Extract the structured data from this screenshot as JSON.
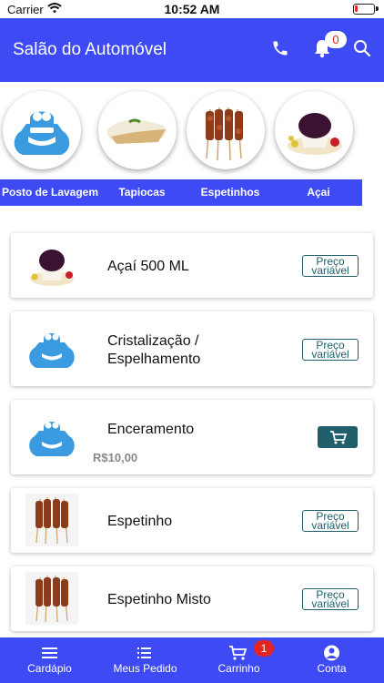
{
  "status_bar": {
    "carrier": "Carrier",
    "time": "10:52 AM",
    "battery_level": 0.15
  },
  "header": {
    "title": "Salão do Automóvel",
    "notification_count": "0"
  },
  "categories": [
    {
      "label": "Posto de Lavagem",
      "icon": "car-wash-logo-icon"
    },
    {
      "label": "Tapiocas",
      "icon": "tapioca-image"
    },
    {
      "label": "Espetinhos",
      "icon": "skewers-image"
    },
    {
      "label": "Açai",
      "icon": "acai-image"
    }
  ],
  "products": [
    {
      "name": "Açaí 500 ML",
      "price_line1": "Preço",
      "price_line2": "variável",
      "icon": "acai-image"
    },
    {
      "name_line1": "Cristalização /",
      "name_line2": "Espelhamento",
      "price_line1": "Preço",
      "price_line2": "variável",
      "icon": "car-wash-logo-icon"
    },
    {
      "name": "Enceramento",
      "price": "R$10,00",
      "icon": "car-wash-logo-icon",
      "action": "cart-icon"
    },
    {
      "name": "Espetinho",
      "price_line1": "Preço",
      "price_line2": "variável",
      "icon": "skewers-image"
    },
    {
      "name": "Espetinho Misto",
      "price_line1": "Preço",
      "price_line2": "variável",
      "icon": "skewers-image"
    }
  ],
  "bottom_nav": {
    "items": [
      {
        "label": "Cardápio",
        "icon": "menu-icon"
      },
      {
        "label": "Meus Pedido",
        "icon": "list-icon"
      },
      {
        "label": "Carrinho",
        "icon": "cart-icon"
      },
      {
        "label": "Conta",
        "icon": "user-icon"
      }
    ],
    "cart_count": "1"
  },
  "colors": {
    "primary": "#3e4bf5",
    "accent": "#1f5f6b",
    "badge": "#e3241f",
    "logo": "#3a9be0"
  }
}
